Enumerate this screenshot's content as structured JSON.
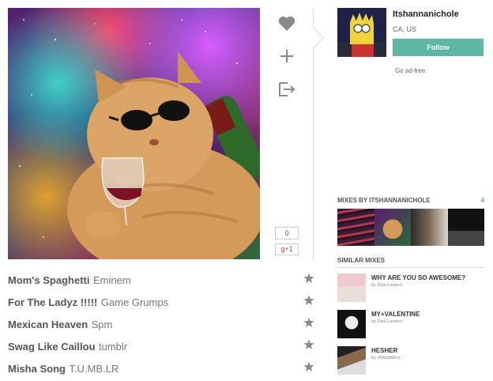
{
  "profile": {
    "username": "Itshannanichole",
    "location": "CA, US",
    "follow_label": "Follow",
    "ad_free_label": "Go ad-free"
  },
  "share": {
    "counter": "0",
    "gplus_label": "g+1"
  },
  "mixes_by": {
    "header": "MIXES BY ITSHANNANICHOLE",
    "count": "4"
  },
  "similar_mixes": {
    "header": "SIMILAR MIXES",
    "items": [
      {
        "title": "WHY ARE YOU SO AWESOME?",
        "by": "by Dark Lantern"
      },
      {
        "title": "MY+VALENTINE",
        "by": "by Dark Lantern"
      },
      {
        "title": "HESHER",
        "by": "by xMissBdenx"
      }
    ]
  },
  "tracks": [
    {
      "song": "Mom's Spaghetti",
      "artist": "Eminem"
    },
    {
      "song": "For The Ladyz !!!!!",
      "artist": "Game Grumps"
    },
    {
      "song": "Mexican Heaven",
      "artist": "Spm"
    },
    {
      "song": "Swag Like Caillou",
      "artist": "tumblr"
    },
    {
      "song": "Misha Song",
      "artist": "T.U.MB.LR"
    }
  ],
  "colors": {
    "accent": "#5cb8a4",
    "icon_gray": "#8a8a8a"
  },
  "icons": [
    "heart-icon",
    "plus-icon",
    "share-icon",
    "star-icon"
  ]
}
